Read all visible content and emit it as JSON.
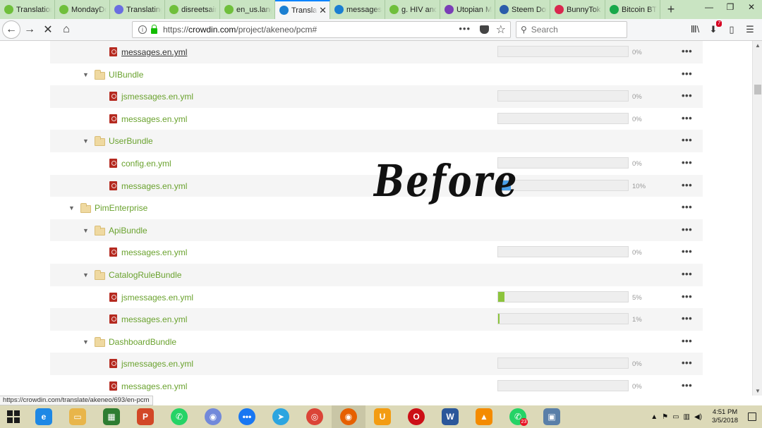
{
  "tabs": [
    {
      "label": "Translation",
      "color": "#6fbf3b",
      "active": false
    },
    {
      "label": "MondayDo",
      "color": "#6fbf3b",
      "active": false
    },
    {
      "label": "Translating",
      "color": "#6a6ee0",
      "active": false
    },
    {
      "label": "disreetsain",
      "color": "#6fbf3b",
      "active": false
    },
    {
      "label": "en_us.lang",
      "color": "#6fbf3b",
      "active": false
    },
    {
      "label": "Transla",
      "color": "#1b7fd1",
      "active": true
    },
    {
      "label": "messages.",
      "color": "#1b7fd1",
      "active": false
    },
    {
      "label": "g. HIV and",
      "color": "#6fbf3b",
      "active": false
    },
    {
      "label": "Utopian M",
      "color": "#7a3fb6",
      "active": false
    },
    {
      "label": "Steem Doll",
      "color": "#2a5caa",
      "active": false
    },
    {
      "label": "BunnyTok",
      "color": "#d9274e",
      "active": false
    },
    {
      "label": "Bitcoin BT",
      "color": "#17a84a",
      "active": false
    }
  ],
  "tab_close": "✕",
  "new_tab": "+",
  "window_controls": {
    "minimize": "—",
    "restore": "❐",
    "close": "✕"
  },
  "nav": {
    "back": "←",
    "forward": "→",
    "stop": "✕",
    "home": "⌂",
    "url_prefix": "https://",
    "url_domain": "crowdin.com",
    "url_path": "/project/akeneo/pcm#",
    "page_actions": "•••",
    "search_placeholder": "Search",
    "notification_badge": "7"
  },
  "tree": [
    {
      "type": "file",
      "name": "messages.en.yml",
      "level": 2,
      "percent": 0,
      "label": "0%",
      "hover": true,
      "alt": true
    },
    {
      "type": "folder",
      "name": "UIBundle",
      "level": 1,
      "alt": false
    },
    {
      "type": "file",
      "name": "jsmessages.en.yml",
      "level": 2,
      "percent": 0,
      "label": "0%",
      "alt": true
    },
    {
      "type": "file",
      "name": "messages.en.yml",
      "level": 2,
      "percent": 0,
      "label": "0%",
      "alt": false
    },
    {
      "type": "folder",
      "name": "UserBundle",
      "level": 1,
      "alt": true
    },
    {
      "type": "file",
      "name": "config.en.yml",
      "level": 2,
      "percent": 0,
      "label": "0%",
      "alt": false
    },
    {
      "type": "file",
      "name": "messages.en.yml",
      "level": 2,
      "percent": 10,
      "label": "10%",
      "fill": "#4a9fe8",
      "alt": true
    },
    {
      "type": "folder",
      "name": "PimEnterprise",
      "level": 0,
      "alt": false
    },
    {
      "type": "folder",
      "name": "ApiBundle",
      "level": 1,
      "alt": true
    },
    {
      "type": "file",
      "name": "messages.en.yml",
      "level": 2,
      "percent": 0,
      "label": "0%",
      "alt": false
    },
    {
      "type": "folder",
      "name": "CatalogRuleBundle",
      "level": 1,
      "alt": true
    },
    {
      "type": "file",
      "name": "jsmessages.en.yml",
      "level": 2,
      "percent": 5,
      "label": "5%",
      "fill": "#8cc43c",
      "alt": false
    },
    {
      "type": "file",
      "name": "messages.en.yml",
      "level": 2,
      "percent": 1,
      "label": "1%",
      "fill": "#8cc43c",
      "alt": true
    },
    {
      "type": "folder",
      "name": "DashboardBundle",
      "level": 1,
      "alt": false
    },
    {
      "type": "file",
      "name": "jsmessages.en.yml",
      "level": 2,
      "percent": 0,
      "label": "0%",
      "alt": true
    },
    {
      "type": "file",
      "name": "messages.en.yml",
      "level": 2,
      "percent": 0,
      "label": "0%",
      "alt": false
    }
  ],
  "row_menu": "•••",
  "watermark": "Before",
  "status_url": "https://crowdin.com/translate/akeneo/693/en-pcm",
  "taskbar": {
    "apps": [
      {
        "name": "internet-explorer",
        "glyph": "e",
        "color": "#1e88e5"
      },
      {
        "name": "file-explorer",
        "glyph": "▭",
        "color": "#e8b54a"
      },
      {
        "name": "store",
        "glyph": "▦",
        "color": "#2e7d32"
      },
      {
        "name": "powerpoint",
        "glyph": "P",
        "color": "#d24726"
      },
      {
        "name": "whatsapp",
        "glyph": "✆",
        "color": "#25d366"
      },
      {
        "name": "discord",
        "glyph": "◉",
        "color": "#7289da"
      },
      {
        "name": "messenger",
        "glyph": "•••",
        "color": "#1877f2"
      },
      {
        "name": "telegram",
        "glyph": "➤",
        "color": "#2ca5e0"
      },
      {
        "name": "chrome",
        "glyph": "◎",
        "color": "#db4437"
      },
      {
        "name": "firefox",
        "glyph": "◉",
        "color": "#e66000",
        "active": true
      },
      {
        "name": "uc-browser",
        "glyph": "U",
        "color": "#f39c12"
      },
      {
        "name": "opera",
        "glyph": "O",
        "color": "#cc0f16"
      },
      {
        "name": "word",
        "glyph": "W",
        "color": "#2b579a"
      },
      {
        "name": "vlc",
        "glyph": "▲",
        "color": "#f48b00"
      },
      {
        "name": "whatsapp-desktop",
        "glyph": "✆",
        "color": "#25d366",
        "badge": "23"
      },
      {
        "name": "photos",
        "glyph": "▣",
        "color": "#5a7fa8"
      }
    ],
    "time": "4:51 PM",
    "date": "3/5/2018"
  }
}
